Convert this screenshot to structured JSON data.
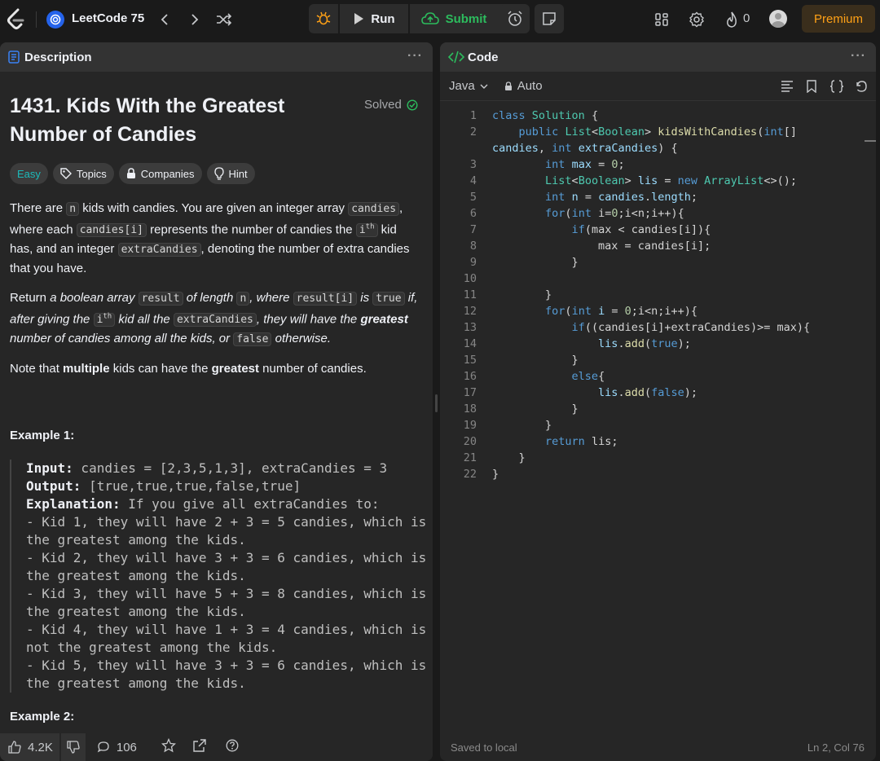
{
  "topbar": {
    "list_title": "LeetCode 75",
    "run_label": "Run",
    "submit_label": "Submit",
    "streak_count": "0",
    "premium_label": "Premium"
  },
  "description_panel": {
    "tab_label": "Description",
    "title_line1": "1431. Kids With the Greatest",
    "title_line2": "Number of Candies",
    "status": "Solved",
    "tags": [
      "Easy",
      "Topics",
      "Companies",
      "Hint"
    ],
    "p1": {
      "a": "There are ",
      "n": "n",
      "b": " kids with candies. You are given an integer array ",
      "candies": "candies",
      "c": ", where each ",
      "candies_i": "candies[i]",
      "d": " represents the number of candies the ",
      "ith": "i",
      "ith_sup": "th",
      "e": " kid has, and an integer ",
      "extra": "extraCandies",
      "f": ", denoting the number of extra candies that you have."
    },
    "p2": {
      "a": "Return ",
      "b": "a boolean array ",
      "result": "result",
      "c": " of length ",
      "n": "n",
      "d": ", where ",
      "result_i": "result[i]",
      "e": " is ",
      "true": "true",
      "f": " if, after giving the ",
      "ith": "i",
      "ith_sup": "th",
      "g": " kid all the ",
      "extra": "extraCandies",
      "h": ", they will have the ",
      "greatest": "greatest",
      "i": " number of candies among all the kids, or ",
      "false": "false",
      "j": " otherwise."
    },
    "p3": {
      "a": "Note that ",
      "multiple": "multiple",
      "b": " kids can have the ",
      "greatest": "greatest",
      "c": " number of candies."
    },
    "example1_heading": "Example 1:",
    "example1": {
      "input_label": "Input:",
      "input_value": " candies = [2,3,5,1,3], extraCandies = 3",
      "output_label": "Output:",
      "output_value": " [true,true,true,false,true]",
      "explanation_label": "Explanation:",
      "explanation_lines": [
        " If you give all extraCandies to:",
        "- Kid 1, they will have 2 + 3 = 5 candies, which is",
        "the greatest among the kids.",
        "- Kid 2, they will have 3 + 3 = 6 candies, which is",
        "the greatest among the kids.",
        "- Kid 3, they will have 5 + 3 = 8 candies, which is",
        "the greatest among the kids.",
        "- Kid 4, they will have 1 + 3 = 4 candies, which is",
        "not the greatest among the kids.",
        "- Kid 5, they will have 3 + 3 = 6 candies, which is",
        "the greatest among the kids."
      ]
    },
    "example2_heading": "Example 2:",
    "footer": {
      "likes": "4.2K",
      "comments": "106"
    }
  },
  "code_panel": {
    "tab_label": "Code",
    "language": "Java",
    "autocomplete": "Auto",
    "saved_status": "Saved to local",
    "cursor_position": "Ln 2, Col 76",
    "line_numbers": [
      "1",
      "2",
      "",
      "3",
      "4",
      "5",
      "6",
      "7",
      "8",
      "9",
      "10",
      "11",
      "12",
      "13",
      "14",
      "15",
      "16",
      "17",
      "18",
      "19",
      "20",
      "21",
      "22"
    ]
  },
  "colors": {
    "accent_orange": "#ffa116",
    "easy_teal": "#1cbaba",
    "submit_green": "#2cbb5d",
    "keyword_blue": "#569cd6"
  }
}
